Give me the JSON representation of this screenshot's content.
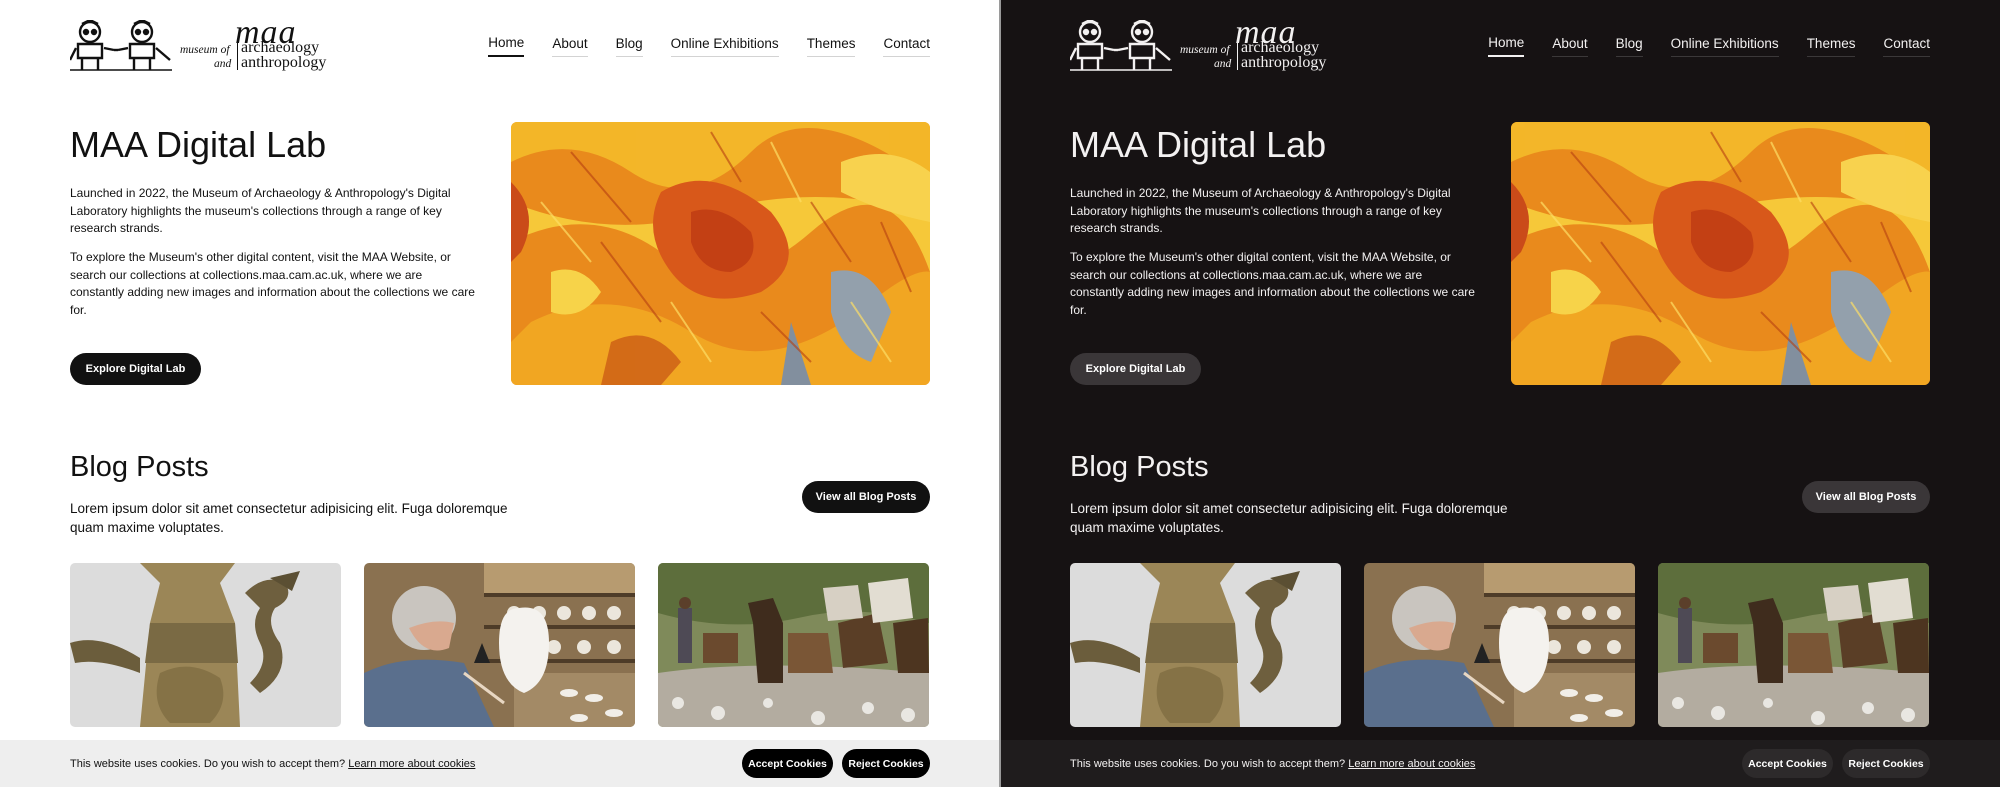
{
  "logo": {
    "maa": "maa",
    "museum_of": "museum of",
    "and": "and",
    "archaeology": "archaeology",
    "anthropology": "anthropology"
  },
  "nav": {
    "items": [
      {
        "label": "Home",
        "active": true
      },
      {
        "label": "About"
      },
      {
        "label": "Blog"
      },
      {
        "label": "Online Exhibitions"
      },
      {
        "label": "Themes"
      },
      {
        "label": "Contact"
      }
    ]
  },
  "hero": {
    "title": "MAA Digital Lab",
    "paragraph1": "Launched in 2022, the Museum of Archaeology & Anthropology's Digital Laboratory highlights the museum's collections through a range of key research strands.",
    "paragraph2": "To explore the Museum's other digital content, visit the MAA Website, or search our collections at collections.maa.cam.ac.uk, where we are constantly adding new images and information about the collections we care for.",
    "button": "Explore Digital Lab"
  },
  "blog": {
    "title": "Blog Posts",
    "description": "Lorem ipsum dolor sit amet consectetur adipisicing elit. Fuga doloremque quam maxime voluptates.",
    "view_all": "View all Blog Posts",
    "cards": [
      {
        "image": "brass-ewer-dragon-image",
        "title": ""
      },
      {
        "image": "ceramic-painter-image",
        "title": ""
      },
      {
        "image": "pack-mules-image",
        "title": ""
      }
    ]
  },
  "cookie": {
    "text": "This website uses cookies. Do you wish to accept them?",
    "link": "Learn more about cookies",
    "accept": "Accept Cookies",
    "reject": "Reject Cookies"
  },
  "colors": {
    "light_bg": "#ffffff",
    "dark_bg": "#161213",
    "light_button": "#111111",
    "dark_button": "#3a3638",
    "feather_orange": "#e9841a",
    "feather_yellow": "#f6c21f"
  }
}
